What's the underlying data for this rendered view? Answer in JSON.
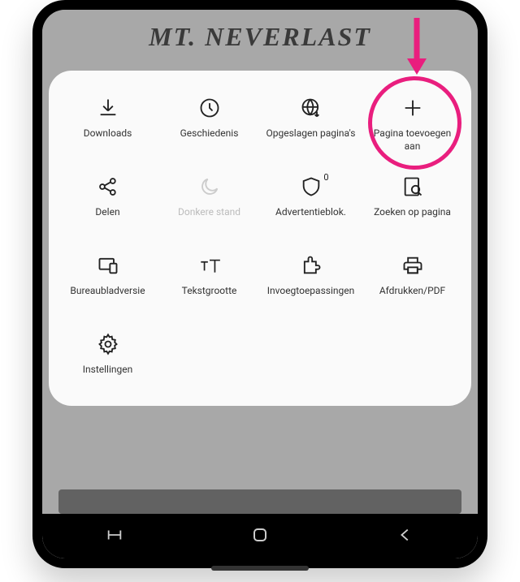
{
  "page_title": "Mt. Neverlast",
  "menu": {
    "items": [
      {
        "id": "downloads",
        "label": "Downloads",
        "icon": "download",
        "disabled": false
      },
      {
        "id": "history",
        "label": "Geschiedenis",
        "icon": "clock",
        "disabled": false
      },
      {
        "id": "saved-pages",
        "label": "Opgeslagen pagina's",
        "icon": "globe-down",
        "disabled": false
      },
      {
        "id": "add-page",
        "label": "Pagina toevoegen aan",
        "icon": "plus",
        "disabled": false
      },
      {
        "id": "share",
        "label": "Delen",
        "icon": "share",
        "disabled": false
      },
      {
        "id": "dark-mode",
        "label": "Donkere stand",
        "icon": "moon",
        "disabled": true
      },
      {
        "id": "adblock",
        "label": "Advertentieblok.",
        "icon": "shield",
        "badge": "0",
        "disabled": false
      },
      {
        "id": "find",
        "label": "Zoeken op pagina",
        "icon": "find",
        "disabled": false
      },
      {
        "id": "desktop",
        "label": "Bureaubladversie",
        "icon": "desktop",
        "disabled": false
      },
      {
        "id": "text-size",
        "label": "Tekstgrootte",
        "icon": "textsize",
        "disabled": false
      },
      {
        "id": "addons",
        "label": "Invoegtoepassingen",
        "icon": "puzzle",
        "disabled": false
      },
      {
        "id": "print",
        "label": "Afdrukken/PDF",
        "icon": "printer",
        "disabled": false
      },
      {
        "id": "settings",
        "label": "Instellingen",
        "icon": "gear",
        "disabled": false
      }
    ]
  },
  "highlight": {
    "target": "add-page",
    "color": "#e91e7e"
  }
}
